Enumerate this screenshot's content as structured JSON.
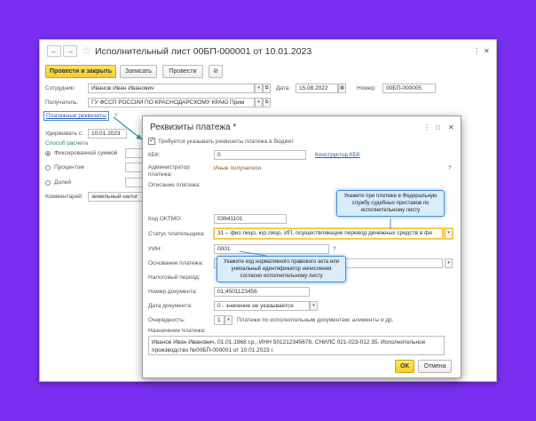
{
  "main": {
    "title": "Исполнительный лист 00БП-000001 от 10.01.2023",
    "nav_back": "←",
    "nav_forward": "→",
    "star": "☆",
    "menu": "⋮",
    "close": "✕",
    "toolbar": {
      "post_close": "Провести и закрыть",
      "save": "Записать",
      "post": "Провести",
      "attach": "⊘"
    },
    "employee_label": "Сотрудник:",
    "employee_value": "Иванов Иван Иванович",
    "date_label": "Дата:",
    "date_value": "15.08.2022",
    "number_label": "Номер:",
    "number_value": "00БП-000005",
    "recipient_label": "Получатель:",
    "recipient_value": "ГУ ФССП РОССИИ ПО КРАСНОДАРСКОМУ КРАЮ Прим",
    "payment_details_link": "Платежные реквизиты",
    "help": "?",
    "withhold_label": "Удерживать с:",
    "withhold_value": "10.01.2023",
    "calc_method_label": "Способ расчета",
    "calc_options": [
      "Фиксированной суммой",
      "Процентом",
      "Долей"
    ],
    "comment_label": "Комментарий:",
    "comment_value": "земельный налог"
  },
  "dialog": {
    "title": "Реквизиты платежа *",
    "require_budget_label": "Требуется указывать реквизиты платежа в бюджет",
    "kbk_label": "КБК:",
    "kbk_value": "0",
    "kbk_constructor": "Конструктор КБК",
    "admin_label_1": "Администратор",
    "admin_label_2": "платежа:",
    "admin_value": "Иные получатели",
    "description_label": "Описание платежа:",
    "oktmo_label": "Код ОКТМО:",
    "oktmo_value": "03641101",
    "payer_status_label": "Статус плательщика:",
    "payer_status_value": "31 – физ.лицо, юр.лицо, ИП, осуществляющие перевод денежных средств в фе",
    "uin_label": "УИН:",
    "uin_value": "0001",
    "basis_label": "Основание платежа:",
    "basis_value": "0",
    "tax_period_label": "Налоговый период:",
    "doc_number_label": "Номер документа:",
    "doc_number_value": "01;4501123456",
    "doc_date_label": "Дата документа:",
    "doc_date_value": "0 - значение не указывается",
    "priority_label": "Очередность:",
    "priority_value": "1",
    "priority_note": "Платежи по исполнительным документам: алименты и др.",
    "purpose_label": "Назначение платежа:",
    "purpose_value": "Иванов Иван Иванович, 01.01.1968 г.р., ИНН 501212345678, СНИЛС 021-023-012 35. Исполнительное производство №00БП-000001 от 10.01.2023 г.",
    "ok": "ОК",
    "cancel": "Отмена",
    "menu": "⋮",
    "minimize": "□",
    "close": "✕"
  },
  "callouts": {
    "top": "Укажите при платеже в Федеральную службу судебных приставов по исполнительному листу",
    "uin": "Укажите код нормативного правового акта или уникальный идентификатор начисления согласно исполнительному листу"
  }
}
